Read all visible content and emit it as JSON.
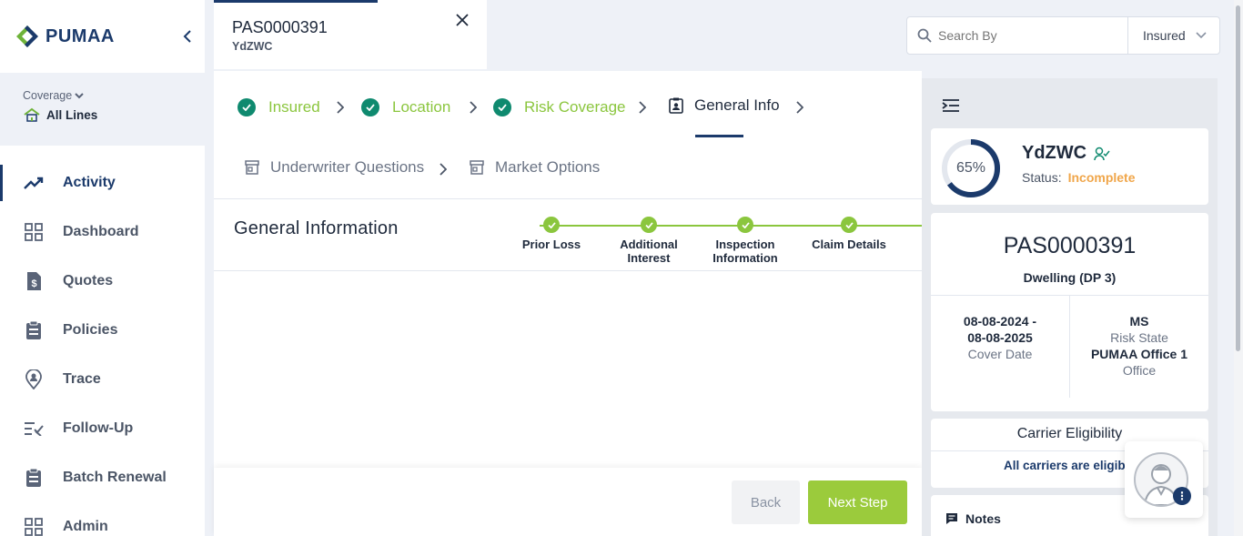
{
  "brand": {
    "name": "PUMAA",
    "color": "#1b3a6b",
    "accent": "#6fb33a"
  },
  "coverage": {
    "label": "Coverage",
    "value": "All Lines"
  },
  "nav": [
    {
      "label": "Activity",
      "icon": "trending-up-icon",
      "active": true
    },
    {
      "label": "Dashboard",
      "icon": "grid-icon"
    },
    {
      "label": "Quotes",
      "icon": "dollar-document-icon"
    },
    {
      "label": "Policies",
      "icon": "clipboard-icon"
    },
    {
      "label": "Trace",
      "icon": "location-user-icon"
    },
    {
      "label": "Follow-Up",
      "icon": "list-check-icon"
    },
    {
      "label": "Batch Renewal",
      "icon": "clipboard-list-icon"
    },
    {
      "label": "Admin",
      "icon": "grid-icon"
    }
  ],
  "tab": {
    "id": "PAS0000391",
    "sub": "YdZWC"
  },
  "search": {
    "placeholder": "Search By",
    "scope": "Insured"
  },
  "steps": [
    {
      "label": "Insured",
      "status": "done"
    },
    {
      "label": "Location",
      "status": "done"
    },
    {
      "label": "Risk Coverage",
      "status": "done"
    },
    {
      "label": "General Info",
      "status": "current"
    },
    {
      "label": "Underwriter Questions",
      "status": "todo"
    },
    {
      "label": "Market Options",
      "status": "todo"
    }
  ],
  "general": {
    "title": "General Information",
    "substeps": [
      {
        "line1": "Prior Loss",
        "line2": ""
      },
      {
        "line1": "Additional",
        "line2": "Interest"
      },
      {
        "line1": "Inspection",
        "line2": "Information"
      },
      {
        "line1": "Claim Details",
        "line2": ""
      }
    ]
  },
  "footer": {
    "back": "Back",
    "next": "Next Step"
  },
  "summary": {
    "progress_percent": 65,
    "progress_label": "65%",
    "insured_name": "YdZWC",
    "status_label": "Status:",
    "status_value": "Incomplete",
    "policy_id": "PAS0000391",
    "policy_type": "Dwelling (DP 3)",
    "cover_date_start": "08-08-2024 -",
    "cover_date_end": "08-08-2025",
    "cover_date_label": "Cover Date",
    "risk_state": "MS",
    "risk_state_label": "Risk State",
    "office": "PUMAA Office 1",
    "office_label": "Office",
    "carrier_title": "Carrier Eligibility",
    "carrier_msg": "All carriers are eligib",
    "notes_label": "Notes"
  },
  "colors": {
    "done_green": "#8bc63e",
    "check_teal": "#0f8a6f",
    "incomplete": "#f0a64a",
    "next_button": "#9bcb3c"
  }
}
